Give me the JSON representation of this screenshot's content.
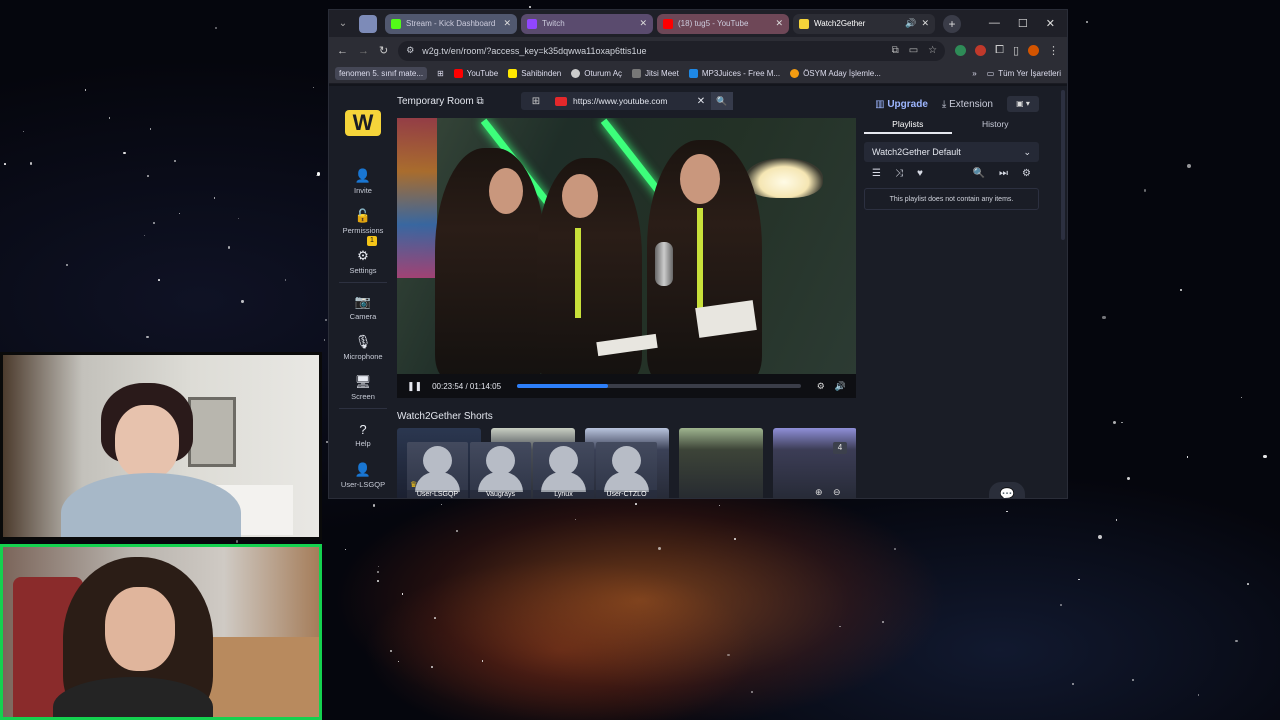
{
  "browser": {
    "tabs": [
      {
        "label": "Stream - Kick Dashboard",
        "fav_color": "#53fc18"
      },
      {
        "label": "Twitch",
        "fav_color": "#9146ff"
      },
      {
        "label": "(18) tug5 - YouTube",
        "fav_color": "#ff0000"
      },
      {
        "label": "Watch2Gether",
        "fav_color": "#f5d43a"
      }
    ],
    "url": "w2g.tv/en/room/?access_key=k35dqwwa11oxap6ttis1ue",
    "bookmarks": [
      {
        "label": "fenomen 5. sınıf mate...",
        "color": "#454756"
      },
      {
        "label": "YouTube",
        "color": "#ff0000"
      },
      {
        "label": "Sahibinden",
        "color": "#ffe800"
      },
      {
        "label": "Oturum Aç",
        "color": "#cccccc"
      },
      {
        "label": "Jitsi Meet",
        "color": "#999999"
      },
      {
        "label": "MP3Juices - Free M...",
        "color": "#1e88e5"
      },
      {
        "label": "ÖSYM Aday İşlemle...",
        "color": "#f39c12"
      }
    ],
    "bookmarks_all": "Tüm Yer İşaretleri",
    "more_bookmarks": "»"
  },
  "w2g": {
    "logo": "W",
    "room_title": "Temporary Room",
    "url_input": "https://www.youtube.com",
    "upgrade_label": "Upgrade",
    "extension_label": "Extension",
    "sidebar": [
      {
        "label": "Invite",
        "icon": "user-plus-icon"
      },
      {
        "label": "Permissions",
        "icon": "lock-icon"
      },
      {
        "label": "Settings",
        "icon": "gear-icon"
      },
      {
        "label": "Camera",
        "icon": "camera-icon"
      },
      {
        "label": "Microphone",
        "icon": "microphone-icon"
      },
      {
        "label": "Screen",
        "icon": "screen-icon"
      },
      {
        "label": "Help",
        "icon": "help-icon"
      },
      {
        "label": "User-LSGQP",
        "icon": "user-icon"
      }
    ],
    "settings_badge": "1",
    "player": {
      "time": "00:23:54 / 01:14:05",
      "progress": 0.32
    },
    "shorts_title": "Watch2Gether Shorts",
    "shorts_count": "4",
    "users": [
      "User-LSGQP",
      "Vaugrays",
      "Lynux",
      "User-CTZLO"
    ],
    "panel": {
      "tab_playlists": "Playlists",
      "tab_history": "History",
      "playlist_name": "Watch2Gether Default",
      "empty_message": "This playlist does not contain any items."
    }
  },
  "colors": {
    "accent": "#2d7ff9",
    "brand": "#f5d43a",
    "cam_border_active": "#14d14f"
  }
}
